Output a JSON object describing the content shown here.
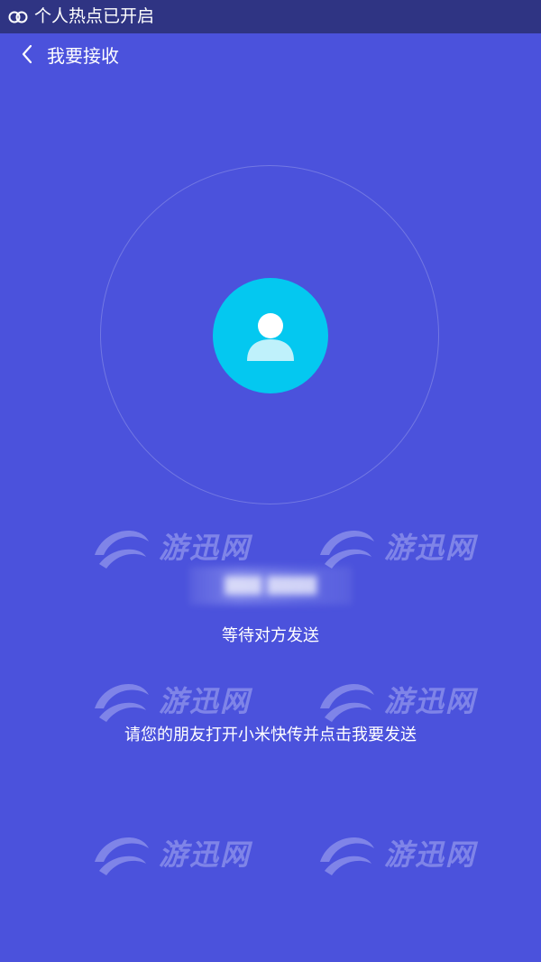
{
  "status_bar": {
    "icon": "hotspot-icon",
    "text": "个人热点已开启"
  },
  "header": {
    "back_icon": "chevron-left-icon",
    "title": "我要接收"
  },
  "receiver": {
    "avatar_icon": "user-icon",
    "device_name": "▓▓▓ ▓▓▓▓",
    "status": "等待对方发送"
  },
  "hint": "请您的朋友打开小米快传并点击我要发送",
  "watermark": "游迅网",
  "colors": {
    "background": "#4b52dc",
    "status_bar": "#2f3483",
    "avatar": "#04c8f0"
  }
}
